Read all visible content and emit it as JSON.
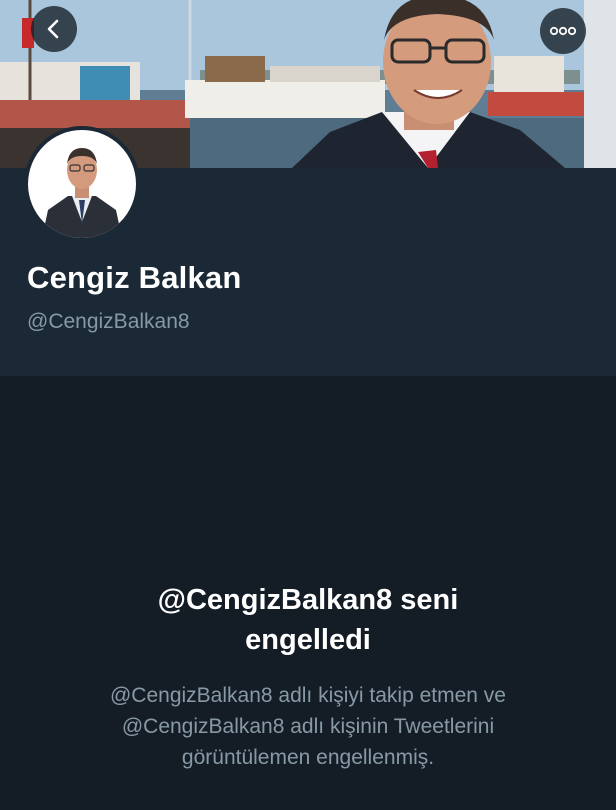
{
  "profile": {
    "display_name": "Cengiz Balkan",
    "handle": "@CengizBalkan8"
  },
  "blocked_notice": {
    "title_line1": "@CengizBalkan8 seni",
    "title_line2": "engelledi",
    "desc_line1": "@CengizBalkan8 adlı kişiyi takip etmen ve",
    "desc_line2": "@CengizBalkan8 adlı kişinin Tweetlerini",
    "desc_line3": "görüntülemen engellenmiş."
  },
  "icons": {
    "back": "chevron-left-icon",
    "more": "more-horizontal-icon"
  },
  "colors": {
    "background": "#141d26",
    "panel": "#1b2836",
    "secondary_text": "#8899a6",
    "primary_text": "#ffffff"
  }
}
